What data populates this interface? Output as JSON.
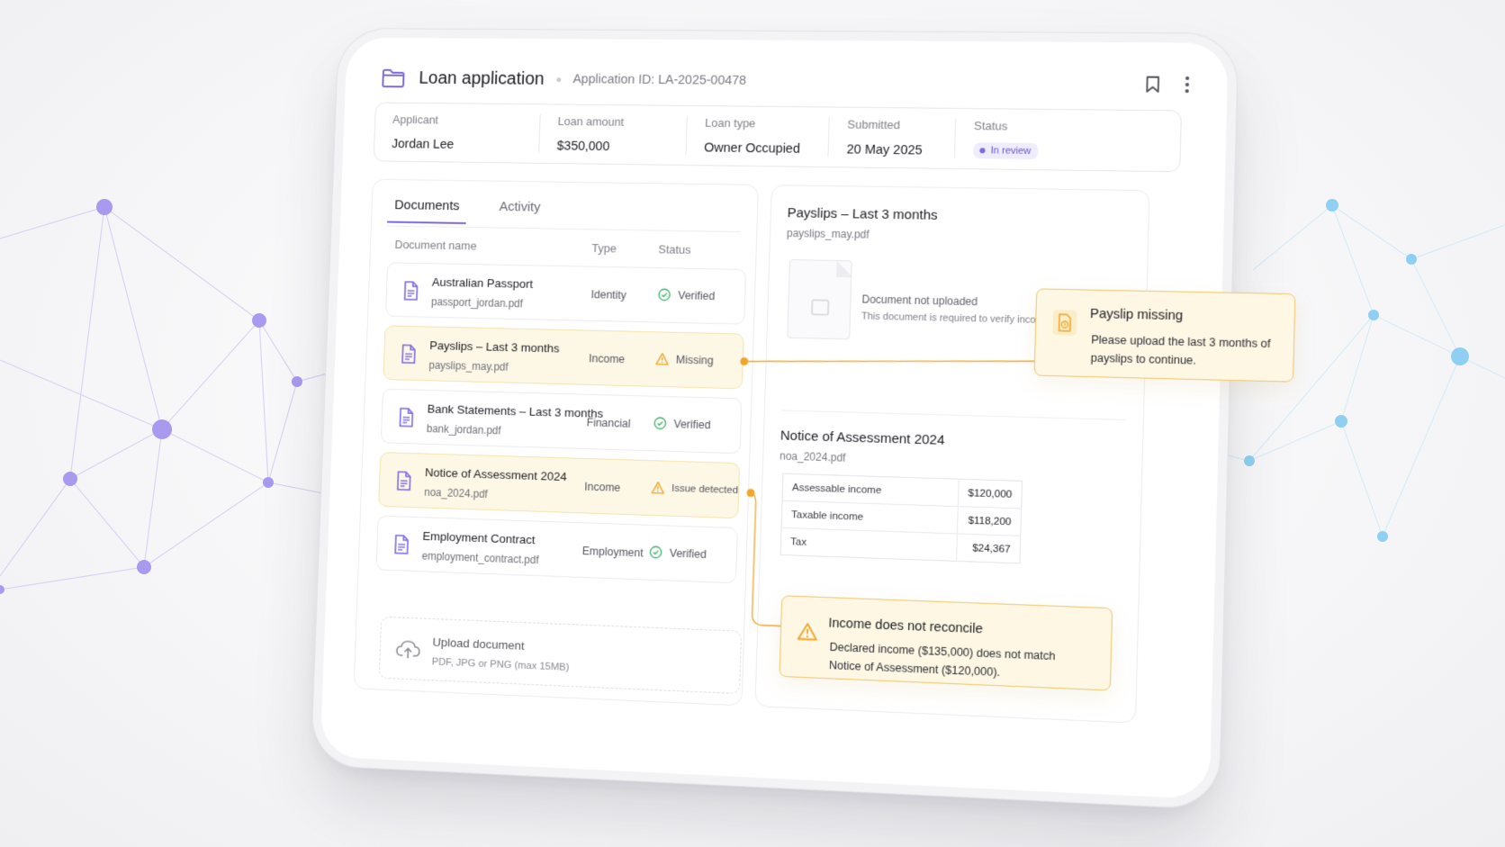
{
  "header": {
    "title": "Loan application",
    "application_id": "Application ID: LA-2025-00478"
  },
  "summary": [
    {
      "label": "Applicant",
      "value": "Jordan Lee"
    },
    {
      "label": "Loan amount",
      "value": "$350,000"
    },
    {
      "label": "Loan type",
      "value": "Owner Occupied"
    },
    {
      "label": "Submitted",
      "value": "20 May 2025"
    },
    {
      "label": "Status",
      "value": "In review"
    }
  ],
  "tabs": [
    {
      "label": "Documents",
      "active": true
    },
    {
      "label": "Activity",
      "active": false
    }
  ],
  "columns": {
    "name": "Document name",
    "type": "Type",
    "status": "Status"
  },
  "documents": [
    {
      "name": "Australian Passport",
      "file": "passport_jordan.pdf",
      "type": "Identity",
      "status": "Verified",
      "state": "ok"
    },
    {
      "name": "Payslips – Last 3 months",
      "file": "payslips_may.pdf",
      "type": "Income",
      "status": "Missing",
      "state": "warn"
    },
    {
      "name": "Bank Statements – Last 3 months",
      "file": "bank_jordan.pdf",
      "type": "Financial",
      "status": "Verified",
      "state": "ok"
    },
    {
      "name": "Notice of Assessment 2024",
      "file": "noa_2024.pdf",
      "type": "Income",
      "status": "Issue detected",
      "state": "warn"
    },
    {
      "name": "Employment Contract",
      "file": "employment_contract.pdf",
      "type": "Employment",
      "status": "Verified",
      "state": "ok"
    }
  ],
  "upload": {
    "title": "Upload document",
    "hint": "PDF, JPG or PNG (max 15MB)"
  },
  "detail_payslips": {
    "title": "Payslips – Last 3 months",
    "file": "payslips_may.pdf",
    "placeholder_title": "Document not uploaded",
    "placeholder_text": "This document is required to verify income."
  },
  "detail_noa": {
    "title": "Notice of Assessment 2024",
    "file": "noa_2024.pdf",
    "rows": [
      {
        "label": "Assessable income",
        "value": "$120,000"
      },
      {
        "label": "Taxable income",
        "value": "$118,200"
      },
      {
        "label": "Tax",
        "value": "$24,367"
      }
    ]
  },
  "alerts": {
    "payslip": {
      "title": "Payslip missing",
      "line1": "Please upload the last 3 months of",
      "line2": "payslips to continue."
    },
    "income": {
      "title": "Income does not reconcile",
      "line1": "Declared income ($135,000) does not match",
      "line2": "Notice of Assessment ($120,000)."
    }
  },
  "colors": {
    "accent": "#7a66e0",
    "warning": "#f0a52c",
    "success": "#3db36b",
    "network_left": "#a99af0",
    "network_right": "#8fd0f2"
  }
}
